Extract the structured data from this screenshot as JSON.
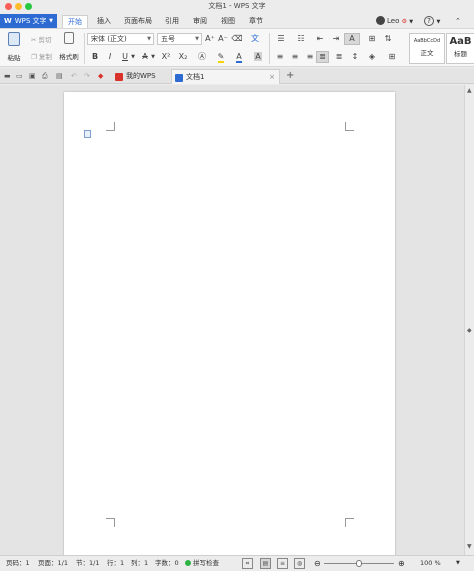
{
  "window": {
    "title": "文档1 - WPS 文字"
  },
  "app_button": {
    "logo": "W",
    "label": "WPS 文字"
  },
  "menu": {
    "tabs": [
      {
        "label": "开始",
        "active": true
      },
      {
        "label": "插入"
      },
      {
        "label": "页面布局"
      },
      {
        "label": "引用"
      },
      {
        "label": "审阅"
      },
      {
        "label": "视图"
      },
      {
        "label": "章节"
      }
    ],
    "user_name": "Leo",
    "help": "?"
  },
  "ribbon": {
    "paste_label": "粘贴",
    "cut_label": "剪切",
    "copy_label": "复制",
    "format_painter_label": "格式刷",
    "font_name": "宋体 (正文)",
    "font_size": "五号",
    "bold": "B",
    "italic": "I",
    "underline": "U",
    "strikethrough": "A",
    "superscript": "X²",
    "subscript": "X₂",
    "font_color": "A",
    "char_shading": "A",
    "styles": [
      {
        "preview": "AaBbCcDd",
        "name": "正文"
      },
      {
        "preview": "AaB",
        "name": "标题"
      }
    ]
  },
  "doc_tabs": [
    {
      "label": "我的WPS",
      "color": "#d9322b"
    },
    {
      "label": "文档1",
      "color": "#2d6bd3",
      "active": true
    }
  ],
  "status": {
    "page_no": "页码：1",
    "pages": "页面：1/1",
    "section": "节：1/1",
    "row": "行：1",
    "col": "列：1",
    "word_count": "字数：0",
    "spell_check": "拼写检查",
    "zoom": "100 %"
  },
  "colors": {
    "brand": "#2d6bd3",
    "font_color_bar": "#2d6bd3",
    "highlight_bar": "#f5d400",
    "shading_bar": "#8a8a8a"
  }
}
